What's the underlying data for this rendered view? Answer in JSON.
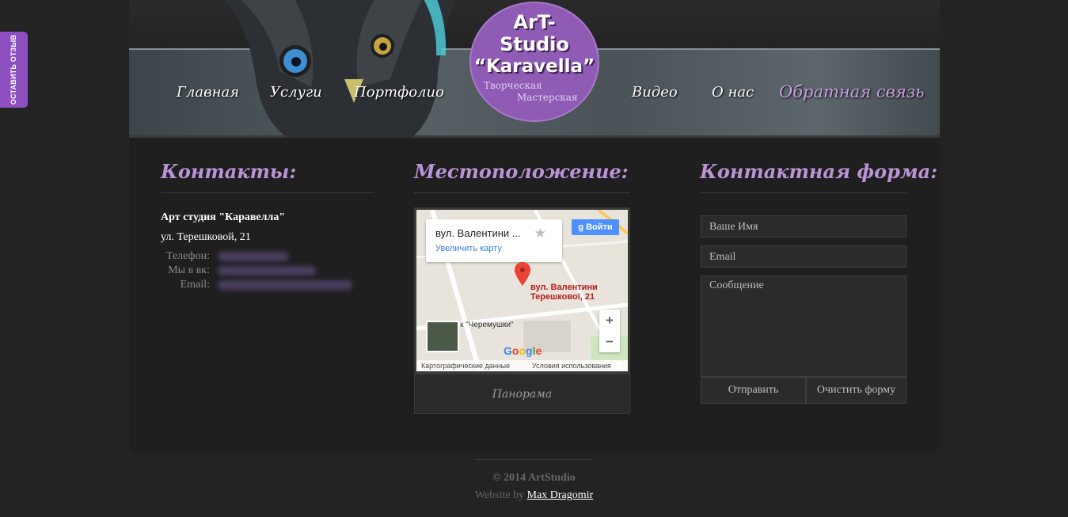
{
  "feedback_tab": {
    "label": "ОСТАВИТЬ ОТЗЫВ"
  },
  "nav": {
    "items": [
      "Главная",
      "Услуги",
      "Портфолио",
      "Видео",
      "О нас"
    ],
    "active": "Обратная связь"
  },
  "logo": {
    "line1": "ArT-",
    "line2": "Studio",
    "line3": "“Karavella”",
    "sub1": "Творческая",
    "sub2": "Мастерская",
    "color": "#8f5bb5"
  },
  "contacts": {
    "title": "Контакты:",
    "name": "Арт студия \"Каравелла\"",
    "address": "ул. Терешковой, 21",
    "phone_label": "Телефон:",
    "vk_label": "Мы в вк:",
    "email_label": "Email:"
  },
  "location": {
    "title": "Местоположение:",
    "map": {
      "info_title": "вул. Валентини ...",
      "zoom_link": "Увеличить карту",
      "signin": "Войти",
      "pin_label": "вул. Валентини Терешкової, 21",
      "poi": "к \"Черемушки\"",
      "google": "Google",
      "footer_data": "Картографические данные",
      "footer_terms": "Условия использования",
      "zoom_in": "+",
      "zoom_out": "−"
    },
    "panorama": "Панорама"
  },
  "form": {
    "title": "Контактная форма:",
    "name_placeholder": "Ваше Имя",
    "email_placeholder": "Email",
    "message_placeholder": "Сообщение",
    "submit": "Отправить",
    "reset": "Очистить форму"
  },
  "footer": {
    "copyright": "© 2014 ArtStudio",
    "website_by": "Website by",
    "author": "Max Dragomir"
  },
  "colors": {
    "accent": "#b994d6",
    "background": "#232323",
    "tab": "#8d4fc0"
  }
}
